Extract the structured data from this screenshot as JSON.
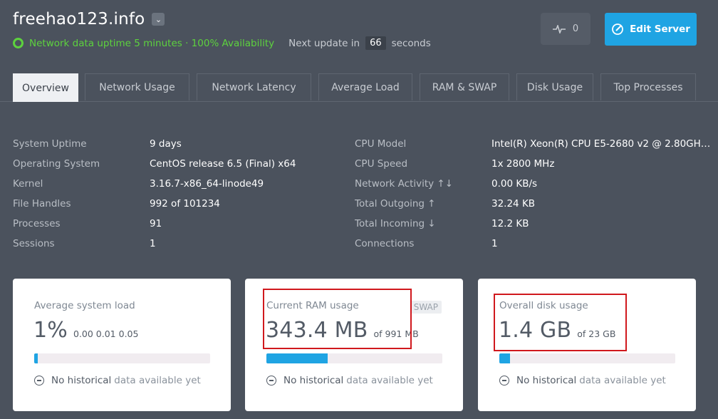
{
  "header": {
    "title": "freehao123.info",
    "caret": "⌄",
    "status_text": "Network data uptime 5 minutes · 100% Availability",
    "next_update_prefix": "Next update in",
    "next_update_count": "66",
    "next_update_suffix": "seconds",
    "pulse_count": "0",
    "edit_label": "Edit Server"
  },
  "tabs": [
    "Overview",
    "Network Usage",
    "Network Latency",
    "Average Load",
    "RAM & SWAP",
    "Disk Usage",
    "Top Processes"
  ],
  "left_info": [
    {
      "label": "System Uptime",
      "value": "9 days"
    },
    {
      "label": "Operating System",
      "value": "CentOS release 6.5 (Final) x64"
    },
    {
      "label": "Kernel",
      "value": "3.16.7-x86_64-linode49"
    },
    {
      "label": "File Handles",
      "value": "992 of 101234"
    },
    {
      "label": "Processes",
      "value": "91"
    },
    {
      "label": "Sessions",
      "value": "1"
    }
  ],
  "right_info": [
    {
      "label": "CPU Model",
      "value": "Intel(R) Xeon(R) CPU E5-2680 v2 @ 2.80GH…"
    },
    {
      "label": "CPU Speed",
      "value": "1x 2800 MHz"
    },
    {
      "label": "Network Activity ↑↓",
      "value": "0.00 KB/s"
    },
    {
      "label": "Total Outgoing ↑",
      "value": "32.24 KB"
    },
    {
      "label": "Total Incoming ↓",
      "value": "12.2 KB"
    },
    {
      "label": "Connections",
      "value": "1"
    }
  ],
  "cards": {
    "load": {
      "title": "Average system load",
      "value": "1%",
      "sub": "0.00 0.01 0.05",
      "fill": 0.01,
      "hist_a": "No historical",
      "hist_b": "data available yet"
    },
    "ram": {
      "title": "Current RAM usage",
      "value": "343.4 MB",
      "sub": "of 991 MB",
      "badge": "SWAP",
      "fill": 0.35,
      "hist_a": "No historical",
      "hist_b": "data available yet"
    },
    "disk": {
      "title": "Overall disk usage",
      "value": "1.4 GB",
      "sub": "of 23 GB",
      "fill": 0.06,
      "hist_a": "No historical",
      "hist_b": "data available yet"
    }
  },
  "colors": {
    "accent": "#1fa4e3",
    "status": "#5dd23e",
    "highlight": "#d0181d"
  }
}
